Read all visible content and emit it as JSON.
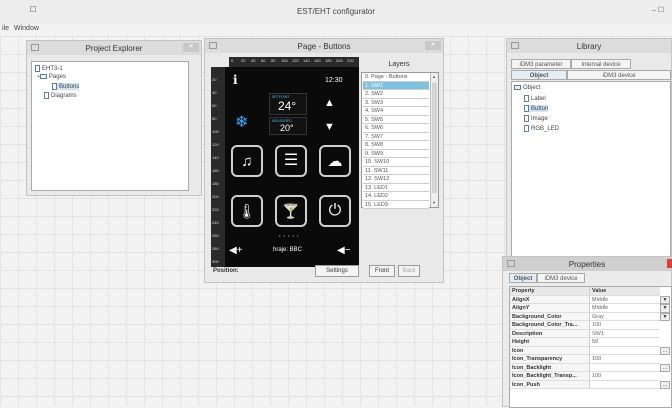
{
  "app": {
    "title": "EST/EHT configurator",
    "menu": [
      "ile",
      "Window"
    ]
  },
  "project_explorer": {
    "title": "Project Explorer",
    "tree": [
      {
        "label": "EHT3-1",
        "icon": "doc-icon"
      },
      {
        "label": "Pages",
        "icon": "folder-icon"
      },
      {
        "label": "Buttons",
        "icon": "doc-icon",
        "selected": true
      },
      {
        "label": "Diagrams",
        "icon": "doc-icon"
      }
    ]
  },
  "page_window": {
    "title": "Page - Buttons",
    "ruler_top": [
      "0",
      "20",
      "40",
      "60",
      "80",
      "100",
      "120",
      "140",
      "160",
      "180",
      "200",
      "220"
    ],
    "ruler_left": [
      "20",
      "40",
      "60",
      "80",
      "100",
      "120",
      "140",
      "160",
      "180",
      "200",
      "220",
      "240",
      "260",
      "280",
      "300"
    ],
    "device": {
      "time": "12:30",
      "setpoint_label": "SETPOINT",
      "setpoint_value": "24°",
      "measured_label": "MEASURED",
      "measured_value": "20°",
      "footer_text": "hraje: BBC",
      "dots": "• • • • •"
    },
    "position_label": "Position:",
    "settings_label": "Settings",
    "front_label": "Front",
    "back_label": "Back",
    "layers": {
      "title": "Layers",
      "items": [
        "0. Page - Buttons",
        "1. SW1",
        "2. SW2",
        "3. SW3",
        "4. SW4",
        "5. SW5",
        "6. SW6",
        "7. SW7",
        "8. SW8",
        "9. SW9",
        "10. SW10",
        "11. SW11",
        "12. SW12",
        "13. LED1",
        "14. LED2",
        "15. LED3"
      ],
      "selected_index": 1
    }
  },
  "library": {
    "title": "Library",
    "top_tabs": [
      "iDM3 parameter",
      "Internal device"
    ],
    "sub_tabs": [
      "Object",
      "iDM3 device"
    ],
    "tree": [
      {
        "label": "Object",
        "icon": "folder-icon"
      },
      {
        "label": "Label",
        "icon": "doc-icon"
      },
      {
        "label": "Button",
        "icon": "doc-icon",
        "selected": true
      },
      {
        "label": "Image",
        "icon": "doc-icon"
      },
      {
        "label": "RGB_LED",
        "icon": "doc-icon"
      }
    ]
  },
  "properties": {
    "title": "Properties",
    "tabs": [
      "Object",
      "iDM3 device"
    ],
    "header": {
      "property": "Property",
      "value": "Value"
    },
    "rows": [
      {
        "name": "AlignX",
        "value": "Middle",
        "control": "dropdown"
      },
      {
        "name": "AlignY",
        "value": "Middle",
        "control": "dropdown"
      },
      {
        "name": "Background_Color",
        "value": "Gray",
        "control": "dropdown"
      },
      {
        "name": "Background_Color_Tra...",
        "value": "100",
        "control": ""
      },
      {
        "name": "Description",
        "value": "SW1",
        "control": ""
      },
      {
        "name": "Height",
        "value": "50",
        "control": ""
      },
      {
        "name": "Icon",
        "value": "",
        "control": "ellipsis"
      },
      {
        "name": "Icon_Transparency",
        "value": "100",
        "control": ""
      },
      {
        "name": "Icon_Backlight",
        "value": "",
        "control": "ellipsis"
      },
      {
        "name": "Icon_Backlight_Transp...",
        "value": "100",
        "control": ""
      },
      {
        "name": "Icon_Push",
        "value": "",
        "control": "ellipsis"
      }
    ]
  },
  "colors": {
    "accent": "#7fc2de",
    "device_bg": "#000000",
    "selection": "#cfe3f3"
  }
}
